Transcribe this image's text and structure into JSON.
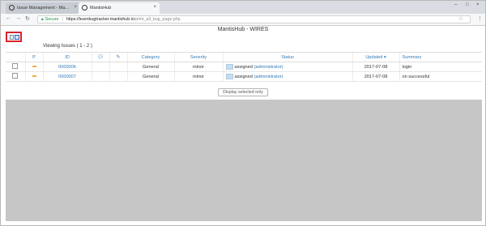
{
  "browser": {
    "tabs": [
      {
        "label": "Issue Management - Ma..."
      },
      {
        "label": "MantisHub"
      }
    ],
    "omnibox": {
      "secure_label": "Secure",
      "url_host": "https://learnbugtracker.mantishub.io",
      "url_path": "/print_all_bug_page.php"
    }
  },
  "page": {
    "title": "MantisHub - WIRES",
    "viewing_label": "Viewing Issues ( 1 - 2 )",
    "columns": [
      "",
      "P",
      "ID",
      "",
      "",
      "Category",
      "Severity",
      "Status",
      "Updated ▾",
      "Summary"
    ],
    "rows": [
      {
        "id": "0000006",
        "category": "General",
        "severity": "minor",
        "status": "assigned",
        "assignee": "(administrator)",
        "updated": "2017-07-08",
        "summary": "login"
      },
      {
        "id": "0000007",
        "category": "General",
        "severity": "minor",
        "status": "assigned",
        "assignee": "(administrator)",
        "updated": "2017-07-08",
        "summary": "on successful"
      }
    ],
    "display_selected_label": "Display selected only"
  },
  "colors": {
    "link": "#337ab7",
    "highlight_border": "#d9232d",
    "priority": "#f0ad4e",
    "status_assigned": "#c9dcf0"
  }
}
